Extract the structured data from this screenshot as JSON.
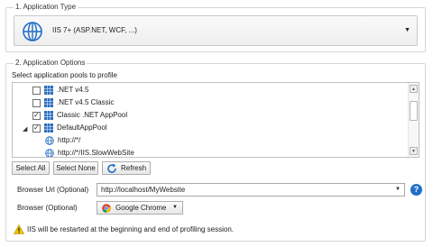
{
  "application_type": {
    "legend": "1. Application Type",
    "selected": "IIS 7+ (ASP.NET, WCF, ...)",
    "icon": "globe-icon"
  },
  "application_options": {
    "legend": "2. Application Options",
    "pools_caption": "Select application pools to profile",
    "pools": [
      {
        "label": ".NET v4.5",
        "checked": false,
        "icon": "app-pool-icon"
      },
      {
        "label": ".NET v4.5 Classic",
        "checked": false,
        "icon": "app-pool-icon"
      },
      {
        "label": "Classic .NET AppPool",
        "checked": true,
        "icon": "app-pool-icon"
      },
      {
        "label": "DefaultAppPool",
        "checked": true,
        "expanded": true,
        "icon": "app-pool-icon"
      },
      {
        "label": "http://*/",
        "icon": "globe-icon"
      },
      {
        "label": "http://*/IIS.SlowWebSite",
        "icon": "globe-icon"
      }
    ],
    "buttons": {
      "select_all": "Select All",
      "select_none": "Select None",
      "refresh": "Refresh"
    },
    "browser_url": {
      "label": "Browser Url (Optional)",
      "value": "http://localhost/MyWebsite"
    },
    "browser": {
      "label": "Browser (Optional)",
      "value": "Google Chrome"
    },
    "warning": "IIS will be restarted at the beginning and end of profiling session."
  },
  "colors": {
    "accent_blue": "#1f6fc5",
    "border": "#d6d6d6",
    "warning_yellow": "#f2c200"
  }
}
